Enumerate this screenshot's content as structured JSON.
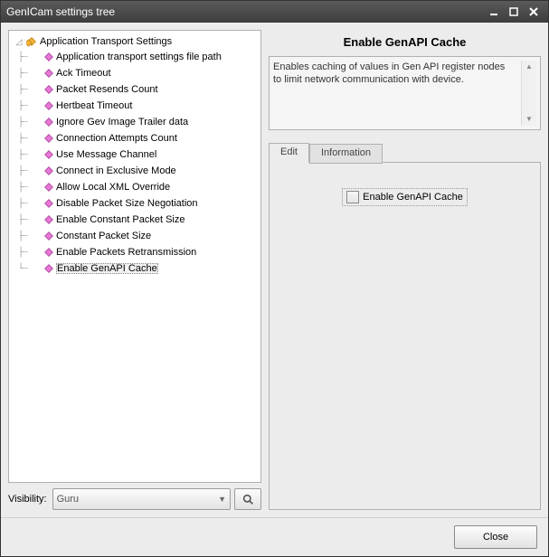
{
  "window": {
    "title": "GenICam settings tree"
  },
  "tree": {
    "root": "Application Transport Settings",
    "items": [
      "Application transport settings file path",
      "Ack Timeout",
      "Packet Resends Count",
      "Hertbeat Timeout",
      "Ignore Gev Image Trailer data",
      "Connection Attempts Count",
      "Use Message Channel",
      "Connect in Exclusive Mode",
      "Allow Local XML Override",
      "Disable Packet Size Negotiation",
      "Enable Constant Packet Size",
      "Constant Packet Size",
      "Enable Packets Retransmission",
      "Enable GenAPI Cache"
    ],
    "selected_index": 13
  },
  "visibility": {
    "label": "Visibility:",
    "value": "Guru"
  },
  "detail": {
    "title": "Enable GenAPI Cache",
    "description": "Enables caching of values in Gen API register nodes to limit network communication with device.",
    "tabs": {
      "edit": "Edit",
      "information": "Information",
      "active": "edit"
    },
    "checkbox": {
      "label": "Enable GenAPI Cache",
      "checked": false
    }
  },
  "footer": {
    "close": "Close"
  }
}
